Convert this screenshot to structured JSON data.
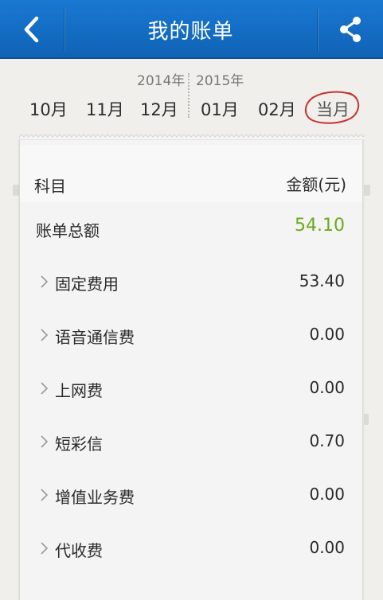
{
  "header": {
    "title": "我的账单",
    "back_icon": "chevron-left-icon",
    "share_icon": "share-icon",
    "background_color": "#1269c4"
  },
  "month_selector": {
    "year_left": "2014年",
    "year_right": "2015年",
    "months": [
      "10月",
      "11月",
      "12月",
      "01月",
      "02月",
      "当月"
    ],
    "current_circle_color": "#c9302c"
  },
  "bill": {
    "header": {
      "subject": "科目",
      "amount": "金额(元)"
    },
    "total": {
      "label": "账单总额",
      "value": "54.10",
      "color": "#6aaa1e"
    },
    "items": [
      {
        "label": "固定费用",
        "value": "53.40"
      },
      {
        "label": "语音通信费",
        "value": "0.00"
      },
      {
        "label": "上网费",
        "value": "0.00"
      },
      {
        "label": "短彩信",
        "value": "0.70"
      },
      {
        "label": "增值业务费",
        "value": "0.00"
      },
      {
        "label": "代收费",
        "value": "0.00"
      }
    ]
  }
}
